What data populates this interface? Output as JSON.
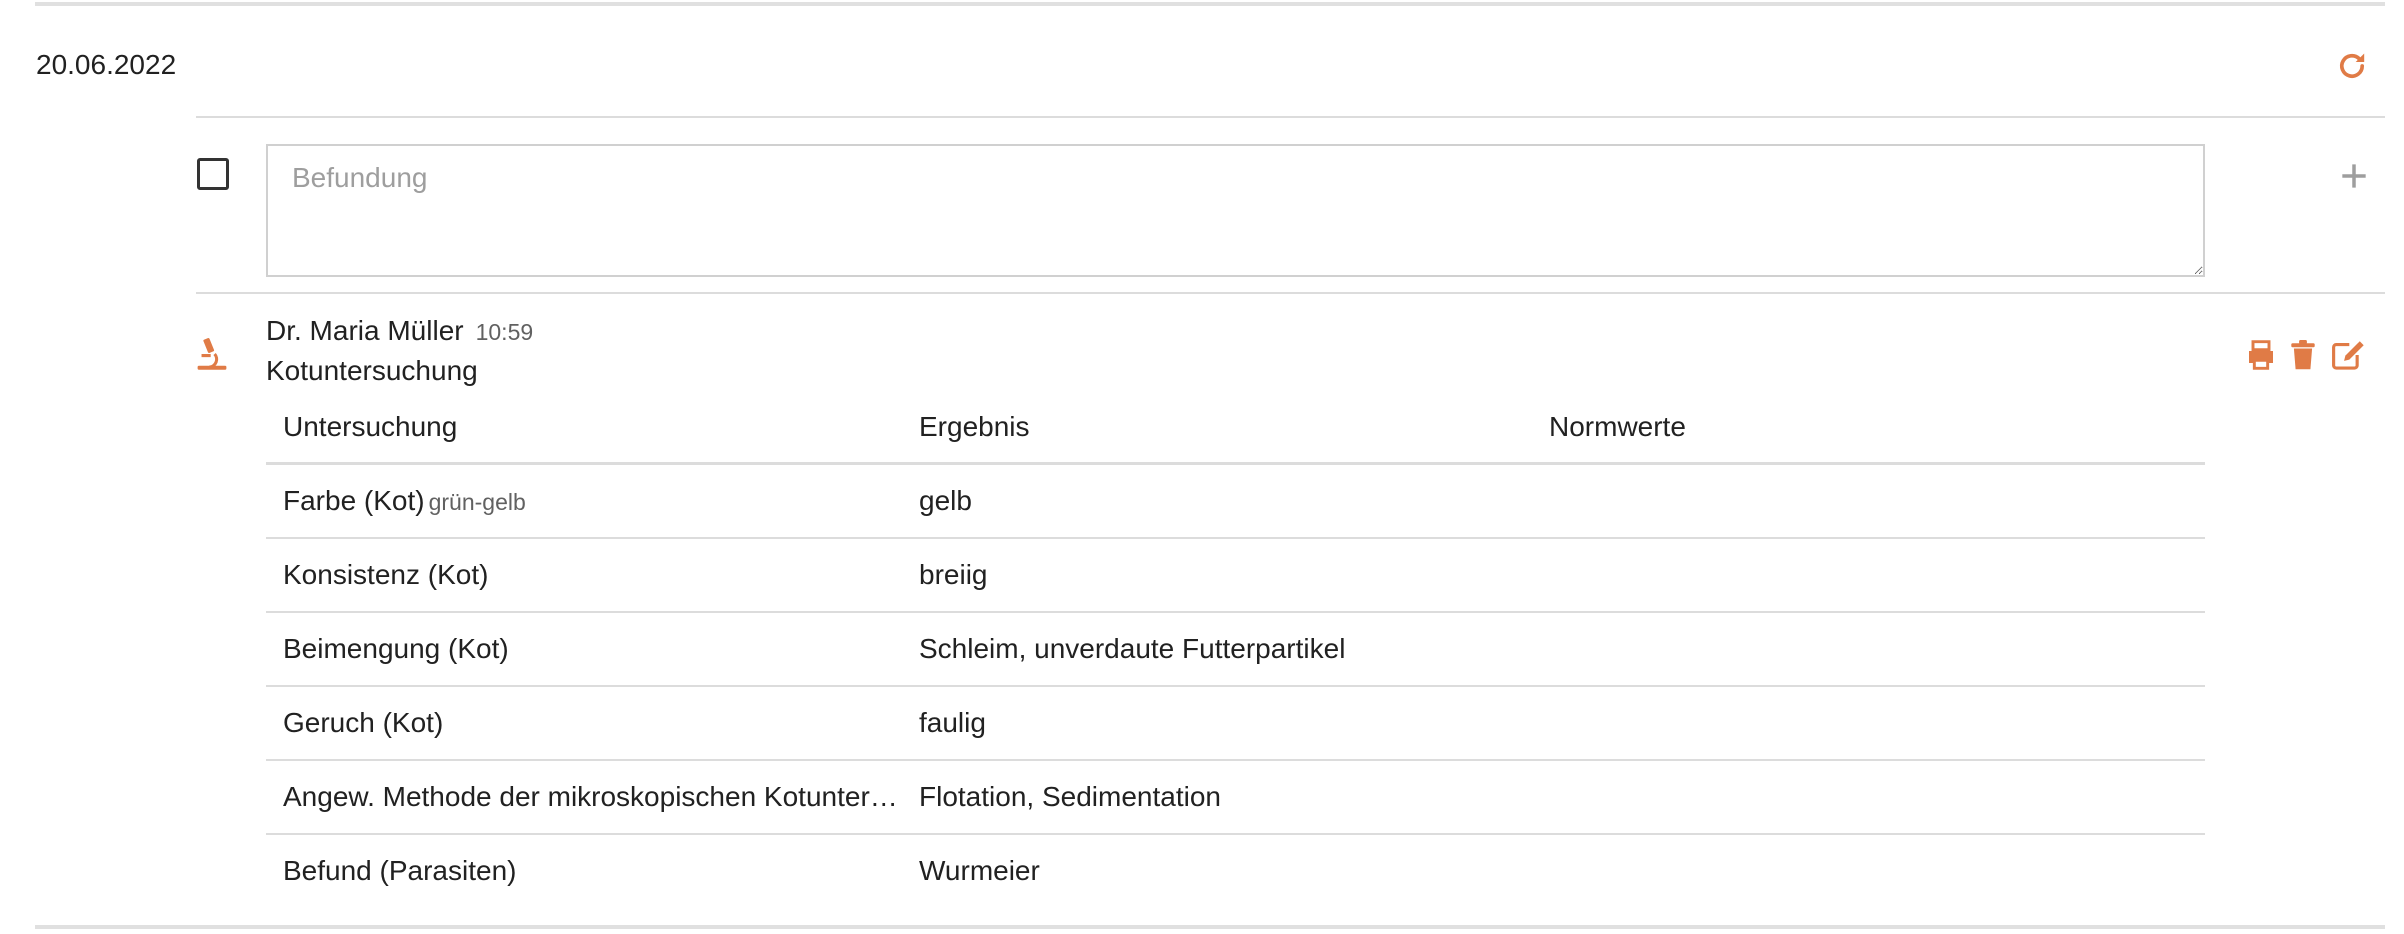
{
  "date": "20.06.2022",
  "input": {
    "placeholder": "Befundung",
    "value": ""
  },
  "entry": {
    "author": "Dr. Maria Müller",
    "time": "10:59",
    "title": "Kotuntersuchung",
    "columns": [
      "Untersuchung",
      "Ergebnis",
      "Normwerte"
    ],
    "rows": [
      {
        "test": "Farbe (Kot)",
        "note": "grün-gelb",
        "result": "gelb",
        "norm": ""
      },
      {
        "test": "Konsistenz (Kot)",
        "note": "",
        "result": "breiig",
        "norm": ""
      },
      {
        "test": "Beimengung (Kot)",
        "note": "",
        "result": "Schleim, unverdaute Futterpartikel",
        "norm": ""
      },
      {
        "test": "Geruch (Kot)",
        "note": "",
        "result": "faulig",
        "norm": ""
      },
      {
        "test": "Angew. Methode der mikroskopischen Kotuntersuchung",
        "note": "",
        "result": "Flotation, Sedimentation",
        "norm": ""
      },
      {
        "test": "Befund (Parasiten)",
        "note": "",
        "result": "Wurmeier",
        "norm": ""
      }
    ]
  },
  "icons": {
    "refresh": "refresh-icon",
    "add": "plus-icon",
    "lab": "microscope-icon",
    "print": "print-icon",
    "delete": "trash-icon",
    "edit": "edit-icon"
  },
  "colors": {
    "accent": "#e07b46",
    "muted_icon": "#9e9e9e",
    "divider": "#dcdcdc",
    "text": "#212121",
    "secondary_text": "#616161"
  }
}
